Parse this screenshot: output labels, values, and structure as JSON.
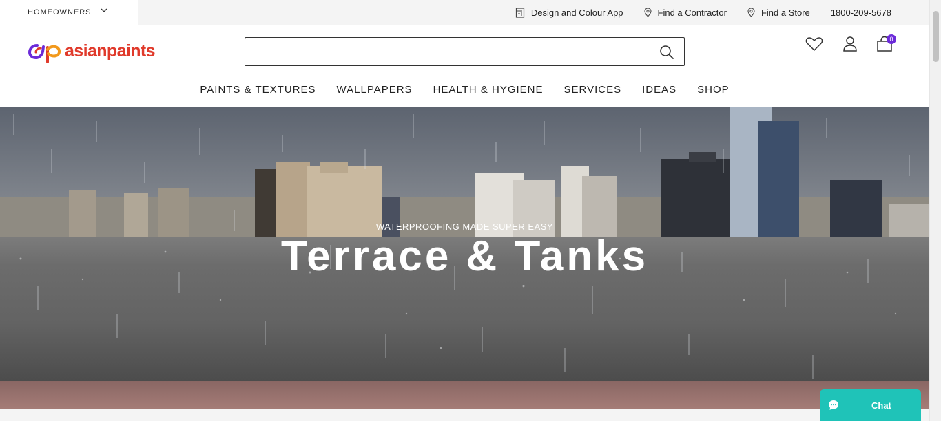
{
  "topbar": {
    "segment_label": "HOMEOWNERS",
    "links": [
      {
        "label": "Design and Colour App",
        "icon": "app-icon"
      },
      {
        "label": "Find a Contractor",
        "icon": "location-pin-icon"
      },
      {
        "label": "Find a Store",
        "icon": "location-pin-icon"
      }
    ],
    "phone": "1800-209-5678"
  },
  "header": {
    "logo_text": "asianpaints",
    "search": {
      "value": "",
      "placeholder": ""
    },
    "cart_count": "0",
    "nav": [
      "PAINTS & TEXTURES",
      "WALLPAPERS",
      "HEALTH & HYGIENE",
      "SERVICES",
      "IDEAS",
      "SHOP"
    ]
  },
  "hero": {
    "eyebrow": "WATERPROOFING MADE SUPER EASY",
    "title": "Terrace & Tanks"
  },
  "chat": {
    "label": "Chat"
  },
  "colors": {
    "brand_red": "#e03a2b",
    "brand_purple": "#6c2bd9",
    "chat_teal": "#1fc3b8"
  }
}
